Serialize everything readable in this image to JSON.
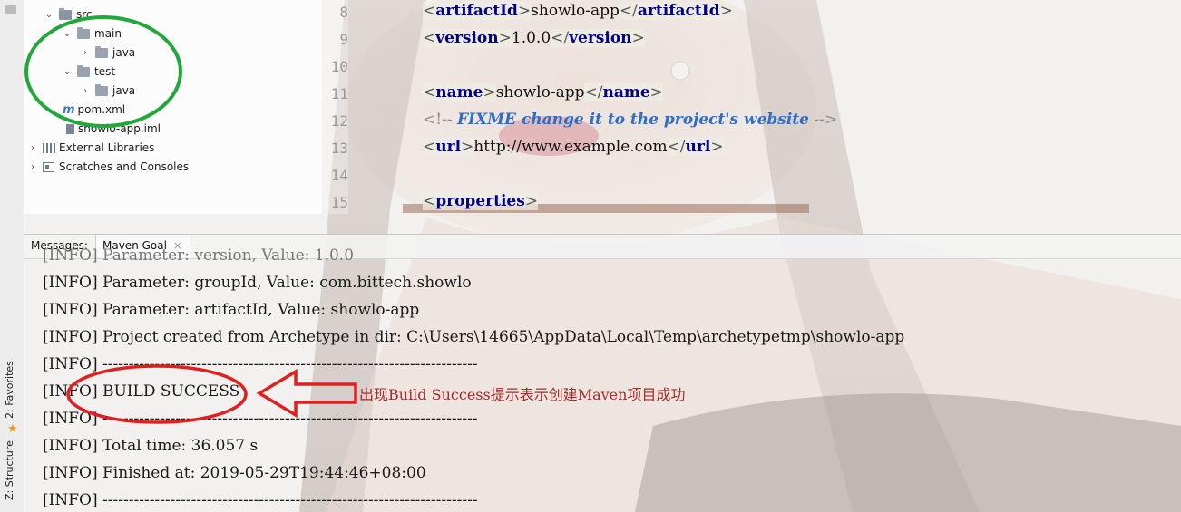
{
  "sidebar_tabs": {
    "favorites": "2: Favorites",
    "structure": "Z: Structure"
  },
  "project_tree": {
    "src": "src",
    "main": "main",
    "main_java": "java",
    "test": "test",
    "test_java": "java",
    "pom": "pom.xml",
    "iml": "showlo-app.iml",
    "external_libraries": "External Libraries",
    "scratches": "Scratches and Consoles"
  },
  "editor": {
    "line_numbers": [
      "8",
      "9",
      "10",
      "11",
      "12",
      "13",
      "14",
      "15"
    ],
    "lines": [
      {
        "tag": "artifactId",
        "value": "showlo-app"
      },
      {
        "tag": "version",
        "value": "1.0.0"
      },
      {
        "tag": "name",
        "value": "showlo-app"
      },
      {
        "comment_open": "<!--",
        "comment_text": "FIXME change it to the project's website",
        "comment_close": "-->"
      },
      {
        "tag": "url",
        "value": "http://www.example.com"
      },
      {
        "tag": "properties"
      }
    ]
  },
  "panel": {
    "messages_label": "Messages:",
    "tab_label": "Maven Goal",
    "tab_close": "×"
  },
  "console": {
    "lines": [
      "[INFO] Parameter: version, Value: 1.0.0",
      "[INFO] Parameter: groupId, Value: com.bittech.showlo",
      "[INFO] Parameter: artifactId, Value: showlo-app",
      "[INFO] Project created from Archetype in dir: C:\\Users\\14665\\AppData\\Local\\Temp\\archetypetmp\\showlo-app",
      "[INFO] ------------------------------------------------------------------------",
      "[INFO] BUILD SUCCESS",
      "[INFO] ------------------------------------------------------------------------",
      "[INFO] Total time:  36.057 s",
      "[INFO] Finished at: 2019-05-29T19:44:46+08:00",
      "[INFO] ------------------------------------------------------------------------"
    ],
    "annotation": "出现Build Success提示表示创建Maven项目成功"
  },
  "colors": {
    "green_circle": "#22a83a",
    "red_annotation": "#e02020",
    "xml_tag": "#000080",
    "comment": "#2e6ec7"
  }
}
